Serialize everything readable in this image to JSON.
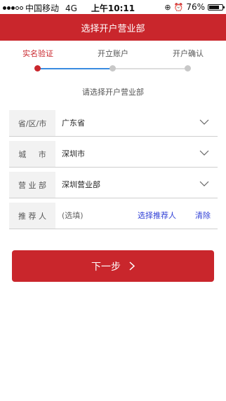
{
  "status_bar": {
    "carrier": "中国移动",
    "network": "4G",
    "time": "上午10:11",
    "battery": "76%",
    "battery_level": 0.76
  },
  "nav": {
    "title": "选择开户营业部"
  },
  "steps": [
    {
      "label": "实名验证",
      "active": true
    },
    {
      "label": "开立账户",
      "active": false
    },
    {
      "label": "开户确认",
      "active": false
    }
  ],
  "hint": "请选择开户营业部",
  "form": {
    "province": {
      "label": "省/区/市",
      "value": "广东省"
    },
    "city": {
      "label": "城     市",
      "value": "深圳市"
    },
    "branch": {
      "label": "营 业 部",
      "value": "深圳营业部"
    },
    "referrer": {
      "label": "推 荐 人",
      "placeholder": "(选填)",
      "select_link": "选择推荐人",
      "clear_link": "清除"
    }
  },
  "next_button": {
    "label": "下一步"
  },
  "colors": {
    "brand_red": "#c9262c",
    "link_blue": "#2f3fd6"
  }
}
